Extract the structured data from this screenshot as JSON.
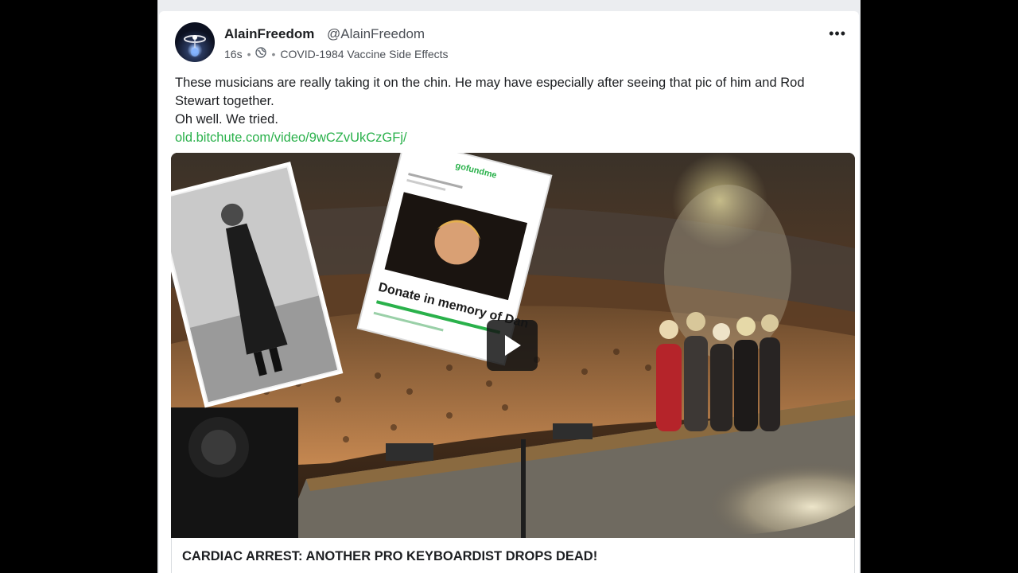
{
  "post": {
    "author_name": "AlainFreedom",
    "author_handle": "@AlainFreedom",
    "time_ago": "16s",
    "group_name": "COVID-1984 Vaccine Side Effects",
    "text_line1": "These musicians are really taking it on the chin. He may have especially after seeing that pic of him and Rod Stewart together.",
    "text_line2": "Oh well. We tried.",
    "link_text": "old.bitchute.com/video/9wCZvUkCzGFj/",
    "media_title": "CARDIAC ARREST:  ANOTHER PRO KEYBOARDIST DROPS DEAD!",
    "more_label": "•••"
  },
  "thumbnail": {
    "inset_header": "gofundme",
    "inset_caption": "Donate in memory of Dan"
  },
  "icons": {
    "more": "more-options-icon",
    "globe": "globe-icon",
    "play": "play-icon"
  },
  "colors": {
    "link": "#2ab14b",
    "text": "#1c1e21",
    "muted": "#4b4f56"
  }
}
